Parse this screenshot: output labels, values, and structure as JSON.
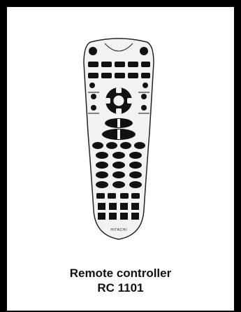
{
  "caption": {
    "title": "Remote controller",
    "model": "RC 1101"
  },
  "remote": {
    "brand_text": "HITACHI"
  },
  "colors": {
    "frame": "#000000",
    "background": "#ffffff",
    "remote_body": "#f2f2f2",
    "buttons": "#111111"
  }
}
